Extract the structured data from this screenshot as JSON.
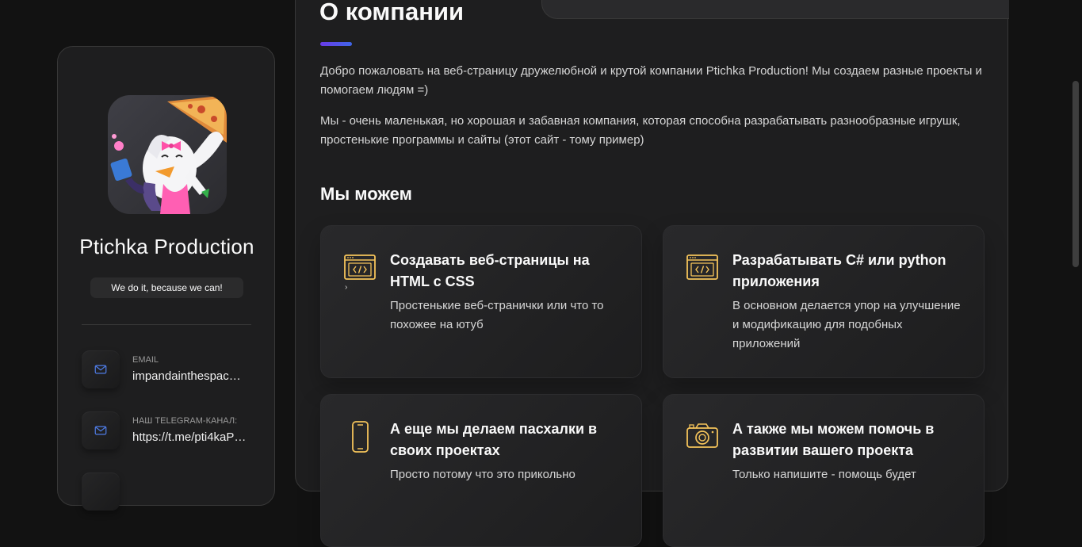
{
  "sidebar": {
    "avatar_alt": "Ptichka Production avatar",
    "name": "Ptichka Production",
    "title": "We do it, because we can!",
    "contacts": [
      {
        "icon": "mail-icon",
        "label": "Email",
        "value": "impandainthespac…"
      },
      {
        "icon": "mail-icon",
        "label": "Наш telegram-канал:",
        "value": "https://t.me/pti4kaP…"
      }
    ]
  },
  "about": {
    "title": "О компании",
    "paragraphs": [
      "Добро пожаловать на веб-страницу дружелюбной и крутой компании Ptichka Production! Мы создаем разные проекты и помогаем людям =)",
      "Мы - очень маленькая, но хорошая и забавная компания, которая способна разрабатывать разнообразные игрушк, простенькие программы и сайты (этот сайт - тому пример)"
    ],
    "services_title": "Мы можем",
    "services": [
      {
        "icon": "code-window-icon",
        "title": "Создавать веб-страницы на HTML с CSS",
        "text": "Простенькие веб-странички или что то похожее на ютуб"
      },
      {
        "icon": "code-window-icon",
        "title": "Разрабатывать C# или python приложения",
        "text": "В основном делается упор на улучшение и модификацию для подобных приложений"
      },
      {
        "icon": "smartphone-icon",
        "title": "А еще мы делаем пасхалки в своих проектах",
        "text": "Просто потому что это прикольно"
      },
      {
        "icon": "camera-icon",
        "title": "А также мы можем помочь в развитии вашего проекта",
        "text": "Только напишите - помощь будет"
      }
    ]
  },
  "colors": {
    "background": "#121212",
    "panel": "#1e1e1f",
    "accent_yellow": "#f4c35a",
    "accent_blue": "#3f66e8",
    "text": "#d6d6d6",
    "heading": "#fafafa"
  }
}
